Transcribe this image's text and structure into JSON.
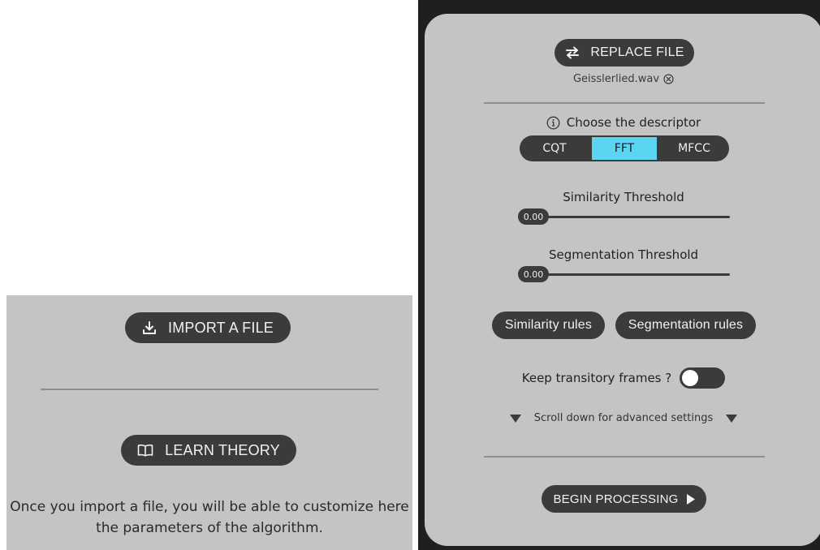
{
  "left_panel": {
    "import_label": "IMPORT A FILE",
    "learn_label": "LEARN THEORY",
    "note": "Once you import a file, you will be able to customize here the parameters of the algorithm."
  },
  "right_panel": {
    "replace_label": "REPLACE FILE",
    "file_name": "Geisslerlied.wav",
    "descriptor_title": "Choose the descriptor",
    "descriptors": [
      "CQT",
      "FFT",
      "MFCC"
    ],
    "selected_descriptor": "FFT",
    "similarity_threshold": {
      "label": "Similarity Threshold",
      "value": "0.00"
    },
    "segmentation_threshold": {
      "label": "Segmentation Threshold",
      "value": "0.00"
    },
    "similarity_rules_label": "Similarity rules",
    "segmentation_rules_label": "Segmentation rules",
    "keep_transitory_label": "Keep transitory frames ?",
    "keep_transitory_on": false,
    "scroll_hint": "Scroll down for advanced settings",
    "begin_label": "BEGIN PROCESSING"
  },
  "colors": {
    "panel_bg": "#c4c4c4",
    "button_bg": "#3b3b3b",
    "accent": "#5ad6f2",
    "frame_bg": "#1f1f1f"
  },
  "icons": [
    "download-icon",
    "book-icon",
    "swap-icon",
    "close-circle-icon",
    "info-icon",
    "triangle-down-icon",
    "play-icon"
  ]
}
